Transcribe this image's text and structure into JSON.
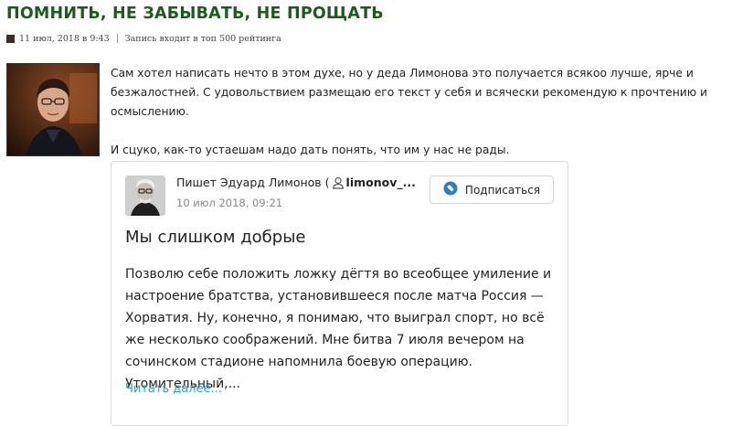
{
  "post": {
    "title": "ПОМНИТЬ, НЕ ЗАБЫВАТЬ, НЕ ПРОЩАТЬ",
    "date": "11 июл, 2018 в 9:43",
    "rating_note": "Запись входит в топ 500 рейтинга",
    "paragraph1": "Сам хотел написать нечто в этом духе, но у деда Лимонова это получается всякоо лучше, ярче и безжалостней. С удовольствием размещаю его текст у себя и всячески рекомендую к прочтению и осмыслению.",
    "paragraph2": "И сцуко, как-то устаешам надо дать понять, что им у нас не рады."
  },
  "embed": {
    "author_prefix": "Пишет Эдуард Лимонов (",
    "author_handle": "limonov_...",
    "date": "10 июл 2018, 09:21",
    "subscribe_label": "Подписаться",
    "title": "Мы слишком добрые",
    "body": "Позволю себе положить ложку дёгтя во всеобщее умиление и настроение братства, установившееся после матча Россия — Хорватия. Ну, конечно, я понимаю, что выиграл спорт, но всё же несколько соображений. Мне битва 7 июля вечером на сочинском стадионе напомнила боевую операцию. Утомительный,...",
    "read_more": "Читать далее..."
  },
  "colors": {
    "title": "#1e5a1e",
    "link": "#3a9bc8",
    "subscribe_icon": "#2b7fc0"
  }
}
